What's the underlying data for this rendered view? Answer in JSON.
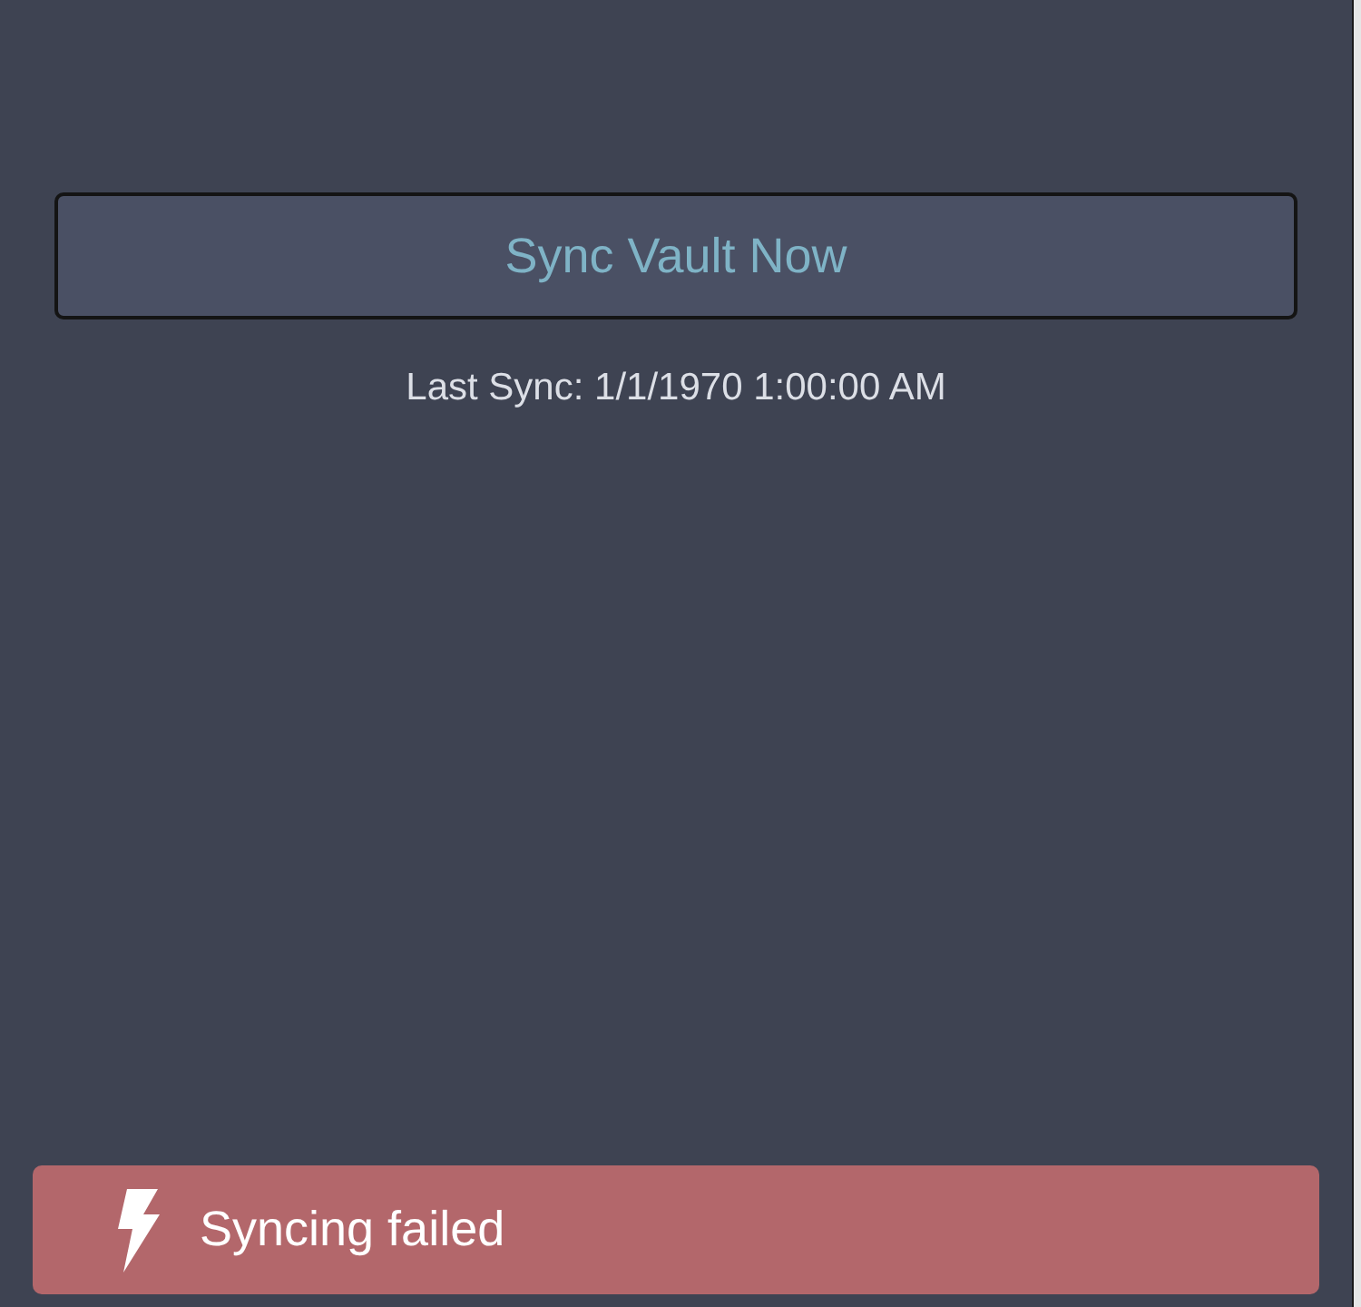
{
  "sync_button": {
    "label": "Sync Vault Now"
  },
  "last_sync": "Last Sync: 1/1/1970 1:00:00 AM",
  "toast": {
    "kind": "error",
    "message": "Syncing failed"
  }
}
